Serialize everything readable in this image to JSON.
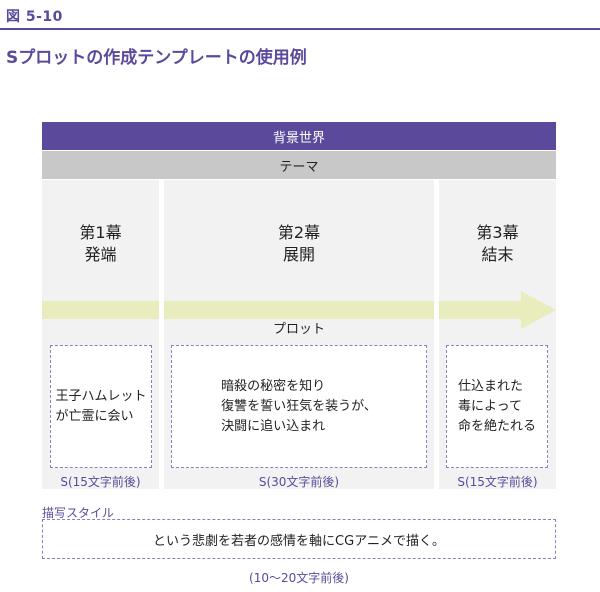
{
  "figure_label": "図 5-10",
  "title": "Sプロットの作成テンプレートの使用例",
  "world": "背景世界",
  "theme": "テーマ",
  "plot": "プロット",
  "acts": [
    {
      "number": "第1幕",
      "name": "発端",
      "text": [
        "王子ハムレット",
        "が亡霊に会い"
      ],
      "count": "S(15文字前後)"
    },
    {
      "number": "第2幕",
      "name": "展開",
      "text": [
        "暗殺の秘密を知り",
        "復讐を誓い狂気を装うが、",
        "決闘に追い込まれ"
      ],
      "count": "S(30文字前後)"
    },
    {
      "number": "第3幕",
      "name": "結末",
      "text": [
        "仕込まれた",
        "毒によって",
        "命を絶たれる"
      ],
      "count": "S(15文字前後)"
    }
  ],
  "description": {
    "label": "描写スタイル",
    "text": "という悲劇を若者の感情を軸にCGアニメで描く。",
    "count": "(10〜20文字前後)"
  },
  "colors": {
    "accent": "#5b4a9c",
    "theme_bar": "#c8c8c8",
    "column": "#f2f2f2",
    "arrow": "#e9ecbc"
  }
}
